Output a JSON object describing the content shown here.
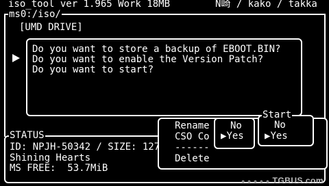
{
  "header": {
    "title": "iso_tool ver 1.965 Work 18MB",
    "credits": "N崎 / kako / takka"
  },
  "main": {
    "path": "ms0:/iso/",
    "location": "[UMD DRIVE]"
  },
  "dialog": {
    "lines": [
      "Do you want to store a backup of EBOOT.BIN?",
      "Do you want to enable the Version Patch?",
      "Do you want to start?"
    ]
  },
  "status": {
    "legend": "STATUS",
    "id_line": "ID: NPJH-50342 / SIZE: 127",
    "title": "Shining Hearts",
    "ms_free": "MS FREE:  53.7MiB"
  },
  "file_menu": {
    "rename": "Rename",
    "cso": "CSO Co",
    "separator": "------",
    "delete": "Delete"
  },
  "cso_choice": {
    "no": "No",
    "yes": "Yes",
    "selected": "yes"
  },
  "start_choice": {
    "legend": "Start",
    "no": "No",
    "yes": "Yes",
    "selected": "yes"
  },
  "watermark": {
    "text": "TGBUS.com",
    "dots": "● ● ● ● ●"
  }
}
